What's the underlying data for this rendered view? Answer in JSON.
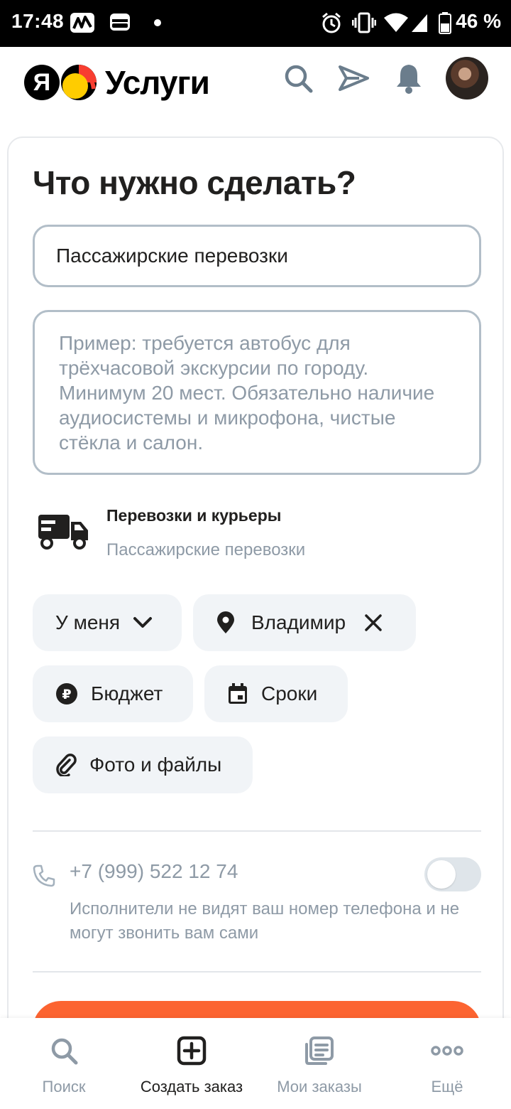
{
  "status_bar": {
    "time": "17:48",
    "battery": "46 %"
  },
  "header": {
    "logo_letter": "Я",
    "logo_text": "Услуги",
    "icons": [
      "search-icon",
      "send-icon",
      "bell-icon",
      "avatar"
    ]
  },
  "form": {
    "title": "Что нужно сделать?",
    "service_value": "Пассажирские перевозки",
    "description_placeholder": "Пример: требуется автобус для трёхчасовой экскурсии по городу. Минимум 20 мест. Обязательно наличие аудиосистемы и микрофона, чистые стёкла и салон.",
    "category": {
      "name": "Перевозки и курьеры",
      "subcategory": "Пассажирские перевозки"
    },
    "chips": {
      "location_mode": "У меня",
      "city": "Владимир",
      "budget": "Бюджет",
      "deadline": "Сроки",
      "attachments": "Фото и файлы"
    },
    "phone": {
      "number": "+7 (999) 522 12 74",
      "hint": "Исполнители не видят ваш номер телефона и не могут звонить вам сами",
      "toggle_on": false
    }
  },
  "bottom_nav": {
    "items": [
      {
        "label": "Поиск",
        "icon": "search-icon"
      },
      {
        "label": "Создать заказ",
        "icon": "plus-square-icon",
        "active": true
      },
      {
        "label": "Мои заказы",
        "icon": "orders-icon"
      },
      {
        "label": "Ещё",
        "icon": "more-icon"
      }
    ]
  },
  "colors": {
    "accent": "#fc6431",
    "muted_text": "#8e9aa6",
    "chip_bg": "#f1f4f7",
    "border": "#b2bec8"
  }
}
